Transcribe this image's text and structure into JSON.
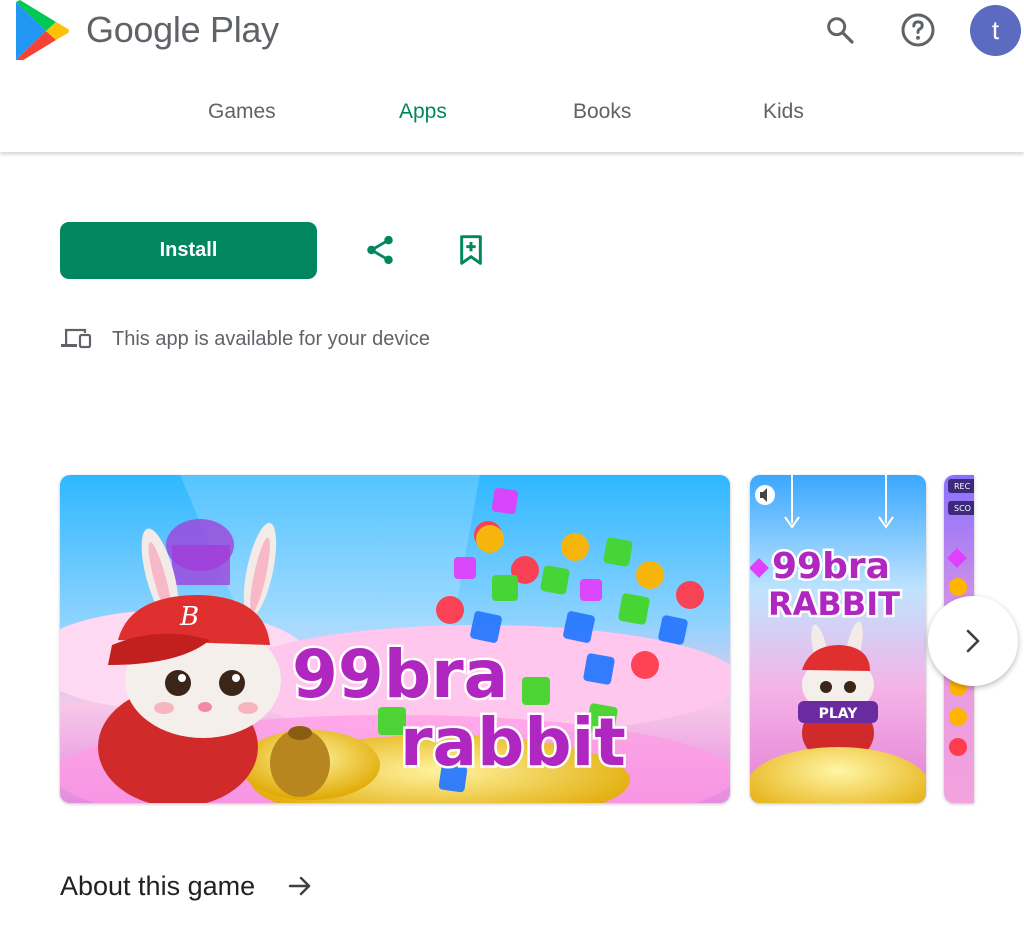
{
  "header": {
    "brand": "Google Play",
    "avatar_letter": "t",
    "icons": {
      "logo": "play-logo-icon",
      "search": "search-icon",
      "help": "help-icon"
    }
  },
  "tabs": [
    {
      "label": "Games",
      "active": false
    },
    {
      "label": "Apps",
      "active": true
    },
    {
      "label": "Books",
      "active": false
    },
    {
      "label": "Kids",
      "active": false
    }
  ],
  "actions": {
    "install_label": "Install",
    "share_icon": "share-icon",
    "wishlist_icon": "bookmark-add-icon"
  },
  "device_note": {
    "icon": "devices-icon",
    "text": "This app is available for your device"
  },
  "screenshots": [
    {
      "title_line1": "99bra",
      "title_line2": "rabbit"
    },
    {
      "title_line1": "99bra",
      "title_line2": "RABBIT",
      "button": "PLAY"
    },
    {
      "labels": [
        "REC",
        "SCO"
      ]
    }
  ],
  "about": {
    "label": "About this game",
    "icon": "arrow-right-icon"
  },
  "colors": {
    "accent": "#01875f",
    "avatar": "#5c6bc0",
    "text_secondary": "#5f6368",
    "title": "#b026c0"
  }
}
